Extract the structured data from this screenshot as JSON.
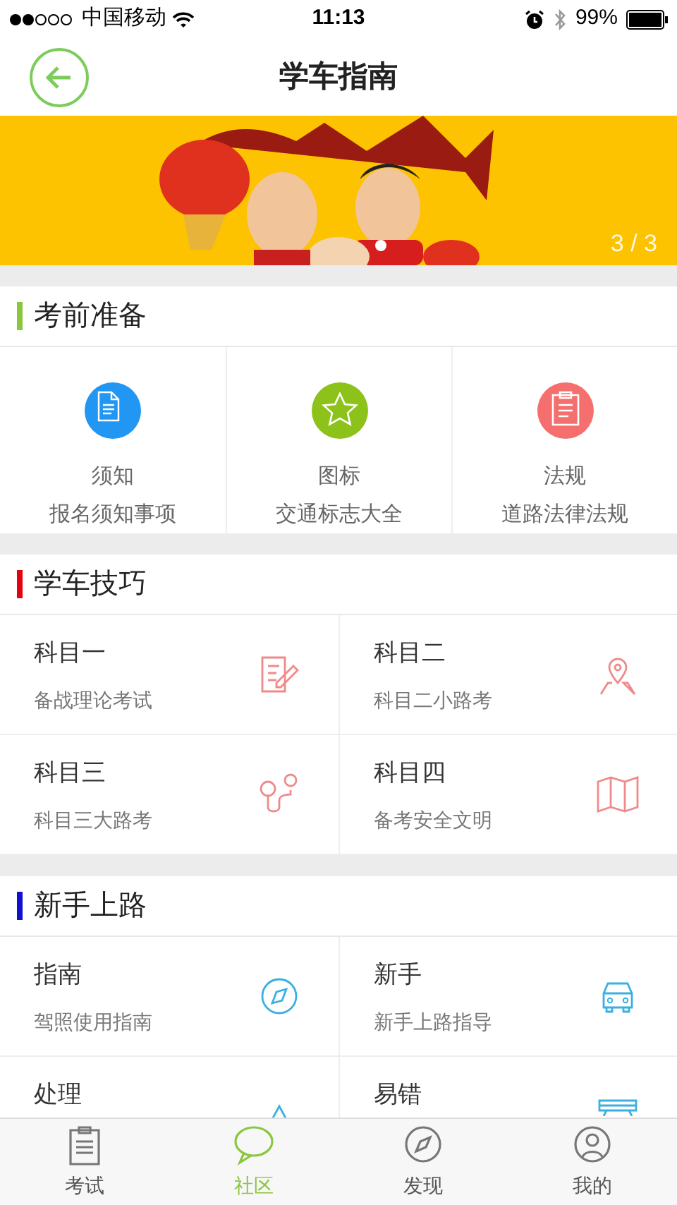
{
  "status_bar": {
    "carrier": "中国移动",
    "time": "11:13",
    "battery": "99%"
  },
  "header": {
    "title": "学车指南"
  },
  "banner": {
    "kind": "picture",
    "page_indicator": "3 / 3"
  },
  "sections": [
    {
      "title": "考前准备",
      "color": "#8cc63f",
      "kind": "grid",
      "items": [
        {
          "title": "须知",
          "subtitle": "报名须知事项",
          "color": "#2196f3"
        },
        {
          "title": "图标",
          "subtitle": "交通标志大全",
          "color": "#8cc21a"
        },
        {
          "title": "法规",
          "subtitle": "道路法律法规",
          "color": "#f56f6f"
        }
      ]
    },
    {
      "title": "学车技巧",
      "color": "#e50012",
      "kind": "list",
      "items": [
        {
          "title": "科目一",
          "subtitle": "备战理论考试"
        },
        {
          "title": "科目二",
          "subtitle": "科目二小路考"
        },
        {
          "title": "科目三",
          "subtitle": "科目三大路考"
        },
        {
          "title": "科目四",
          "subtitle": "备考安全文明"
        }
      ]
    },
    {
      "title": "新手上路",
      "color": "#1010d0",
      "kind": "list",
      "items": [
        {
          "title": "指南",
          "subtitle": "驾照使用指南"
        },
        {
          "title": "新手",
          "subtitle": "新手上路指导"
        },
        {
          "title": "处理"
        },
        {
          "title": "易错"
        }
      ]
    }
  ],
  "tabs": [
    {
      "label": "考试",
      "selected": false
    },
    {
      "label": "社区",
      "selected": true
    },
    {
      "label": "发现",
      "selected": false
    },
    {
      "label": "我的",
      "selected": false
    }
  ]
}
